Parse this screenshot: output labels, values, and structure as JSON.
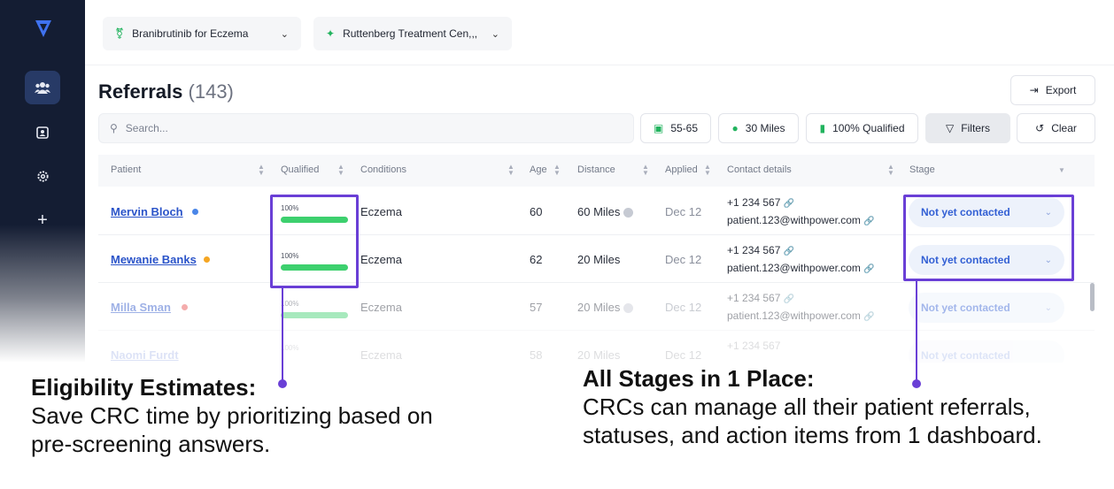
{
  "topbar": {
    "study_selector": "Branibrutinib for Eczema",
    "site_selector": "Ruttenberg Treatment Cen,,,"
  },
  "page": {
    "title": "Referrals",
    "count": "(143)",
    "export_label": "Export"
  },
  "search": {
    "placeholder": "Search..."
  },
  "filters": {
    "chips": [
      "55-65",
      "30 Miles",
      "100% Qualified"
    ],
    "filters_label": "Filters",
    "clear_label": "Clear"
  },
  "table": {
    "columns": [
      "Patient",
      "Qualified",
      "Conditions",
      "Age",
      "Distance",
      "Applied",
      "Contact details",
      "Stage"
    ],
    "rows": [
      {
        "patient": "Mervin Bloch",
        "dot_color": "#4a86e8",
        "qualified": "100%",
        "qualified_level": 1.0,
        "condition": "Eczema",
        "age": "60",
        "distance": "60 Miles",
        "applied": "Dec 12",
        "phone": "+1 234 567",
        "email": "patient.123@withpower.com",
        "stage": "Not yet contacted"
      },
      {
        "patient": "Mewanie Banks",
        "dot_color": "#f5a623",
        "qualified": "100%",
        "qualified_level": 1.0,
        "condition": "Eczema",
        "age": "62",
        "distance": "20 Miles",
        "applied": "Dec 12",
        "phone": "+1 234 567",
        "email": "patient.123@withpower.com",
        "stage": "Not yet contacted"
      },
      {
        "patient": "Milla Sman",
        "dot_color": "#e84a4a",
        "qualified": "100%",
        "qualified_level": 1.0,
        "condition": "Eczema",
        "age": "57",
        "distance": "20 Miles",
        "applied": "Dec 12",
        "phone": "+1 234 567",
        "email": "patient.123@withpower.com",
        "stage": "Not yet contacted"
      },
      {
        "patient": "Naomi Furdt",
        "dot_color": "#4a86e8",
        "qualified": "100%",
        "qualified_level": 1.0,
        "condition": "Eczema",
        "age": "58",
        "distance": "20 Miles",
        "applied": "Dec 12",
        "phone": "+1 234 567",
        "email": "",
        "stage": "Not yet contacted"
      }
    ]
  },
  "captions": {
    "left_heading": "Eligibility Estimates:",
    "left_body": "Save CRC time by prioritizing based on pre-screening answers.",
    "right_heading": "All Stages in 1 Place:",
    "right_body": "CRCs can manage all their patient referrals, statuses, and action items from 1 dashboard."
  },
  "colors": {
    "highlight": "#6a3fd6",
    "accent_blue": "#3360d4",
    "qualified_green": "#3dd06e",
    "sidebar_bg": "#141d33"
  },
  "icons": [
    "logo-icon",
    "users-icon",
    "contact-card-icon",
    "gear-icon",
    "plus-icon",
    "flask-icon",
    "hospital-icon",
    "export-icon",
    "search-icon",
    "id-card-icon",
    "pin-icon",
    "document-check-icon",
    "filter-icon",
    "undo-icon",
    "link-icon",
    "chevron-down-icon"
  ]
}
